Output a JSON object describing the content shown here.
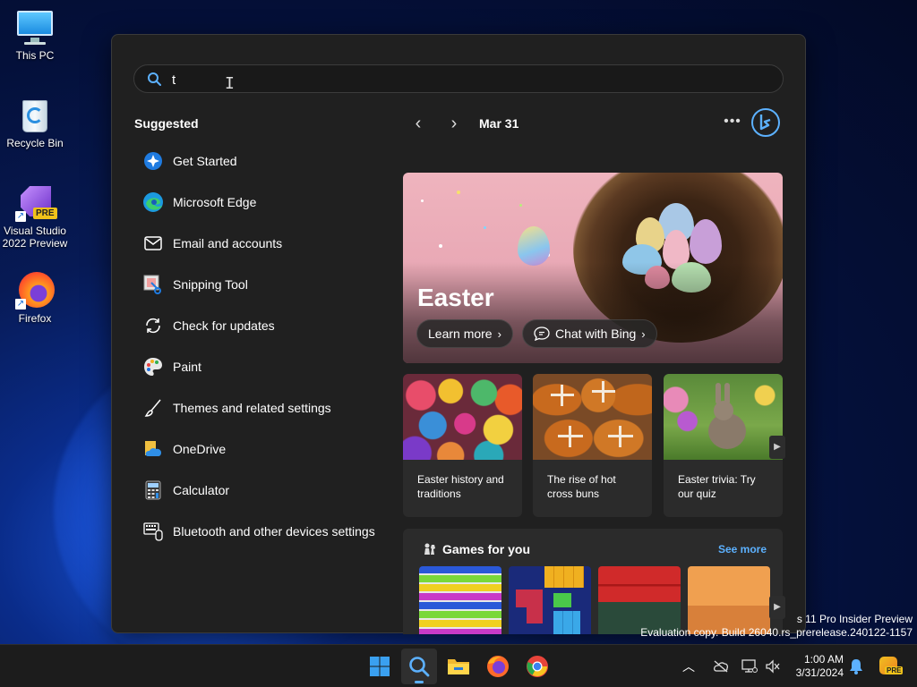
{
  "desktop": {
    "icons": [
      {
        "label": "This PC",
        "icon": "computer-icon"
      },
      {
        "label": "Recycle Bin",
        "icon": "recycle-bin-icon"
      },
      {
        "label": "Visual Studio\n2022 Preview",
        "line1": "Visual Studio",
        "line2": "2022 Preview",
        "badge": "PRE",
        "icon": "visual-studio-icon"
      },
      {
        "label": "Firefox",
        "icon": "firefox-icon"
      }
    ]
  },
  "search": {
    "value": "t",
    "placeholder": ""
  },
  "suggested": {
    "title": "Suggested",
    "items": [
      {
        "label": "Get Started",
        "icon": "get-started-icon"
      },
      {
        "label": "Microsoft Edge",
        "icon": "edge-icon"
      },
      {
        "label": "Email and accounts",
        "icon": "mail-icon"
      },
      {
        "label": "Snipping Tool",
        "icon": "snipping-tool-icon"
      },
      {
        "label": "Check for updates",
        "icon": "refresh-icon"
      },
      {
        "label": "Paint",
        "icon": "paint-icon"
      },
      {
        "label": "Themes and related settings",
        "icon": "brush-icon"
      },
      {
        "label": "OneDrive",
        "icon": "onedrive-icon"
      },
      {
        "label": "Calculator",
        "icon": "calculator-icon"
      },
      {
        "label": "Bluetooth and other devices settings",
        "icon": "devices-icon"
      }
    ]
  },
  "highlights": {
    "date": "Mar 31",
    "hero": {
      "title": "Easter",
      "learn_more": "Learn more",
      "chat": "Chat with Bing"
    },
    "cards": [
      {
        "caption": "Easter history and traditions"
      },
      {
        "caption": "The rise of hot cross buns"
      },
      {
        "caption": "Easter trivia: Try our quiz"
      }
    ],
    "games": {
      "title": "Games for you",
      "see_more": "See more"
    }
  },
  "watermark": {
    "line1": "s 11 Pro Insider Preview",
    "line2": "Evaluation copy. Build 26040.rs_prerelease.240122-1157"
  },
  "taskbar": {
    "time": "1:00 AM",
    "date": "3/31/2024",
    "copilot_badge": "PRE"
  },
  "colors": {
    "accent": "#5cb1ff",
    "panel_bg": "#202020",
    "card_bg": "#2b2b2b"
  }
}
